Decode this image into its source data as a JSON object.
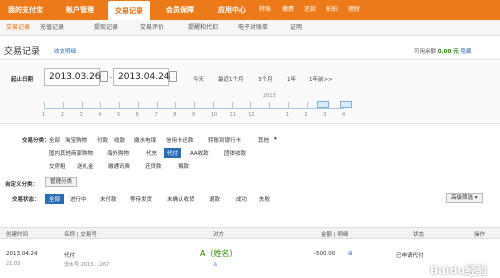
{
  "topbar": {
    "items": [
      "我的支付宝",
      "账户管理",
      "交易记录",
      "会员保障",
      "应用中心"
    ],
    "active": "交易记录",
    "quick": [
      "转账",
      "缴费",
      "还款",
      "拍拍",
      "理财"
    ]
  },
  "subnav": {
    "items": [
      "交易记录",
      "充值记录",
      "提现记录",
      "交易评价",
      "提醒和代扣",
      "电子对账单",
      "证明"
    ]
  },
  "page_title": "交易记录",
  "title_link": "收支明细",
  "balance": {
    "label": "可用余额",
    "value": "0.00 元",
    "toggle": "隐藏"
  },
  "date": {
    "label": "起止日期",
    "start": "2013.03.26",
    "end": "2013.04.24",
    "quick": [
      "今天",
      "最近1个月",
      "3个月",
      "1年",
      "1年前>>"
    ]
  },
  "timeline_labels": [
    "1",
    "2",
    "3",
    "4",
    "5",
    "6",
    "7",
    "8",
    "9",
    "10",
    "11",
    "12",
    "2013",
    "1",
    "2",
    "3",
    "4"
  ],
  "trade_type": {
    "label": "交易分类：",
    "row1": [
      "全部",
      "淘宝购物",
      "付款",
      "收款",
      "缴水电煤",
      "信用卡还款",
      "转账到银行卡",
      "其他"
    ],
    "row2": [
      "国内其他商家购物",
      "海外购物",
      "代充",
      "代付",
      "AA收款",
      "团体收款"
    ],
    "row3": [
      "交房租",
      "送礼金",
      "缴通讯费",
      "还贷款",
      "捐款"
    ],
    "selected": "代付"
  },
  "custom": {
    "label": "自定义分类：",
    "button": "管理分类"
  },
  "status": {
    "label": "交易状态：",
    "items": [
      "全部",
      "进行中",
      "未付款",
      "等待发货",
      "未确认收货",
      "退款",
      "成功",
      "失败"
    ],
    "selected": "全部",
    "advanced": "高级筛选"
  },
  "table": {
    "headers": [
      "创建时间",
      "名称 | 交易号",
      "对方",
      "金额 | 明细",
      "状态",
      "操作"
    ],
    "rows": [
      {
        "date": "2013.04.24",
        "time": "21:03",
        "name": "代付",
        "trade_no": "流水号 2013....267",
        "counterparty": "A（姓名）",
        "amount": "-500.00",
        "status": "已申请代付"
      }
    ]
  },
  "watermark": "Baidu经验"
}
